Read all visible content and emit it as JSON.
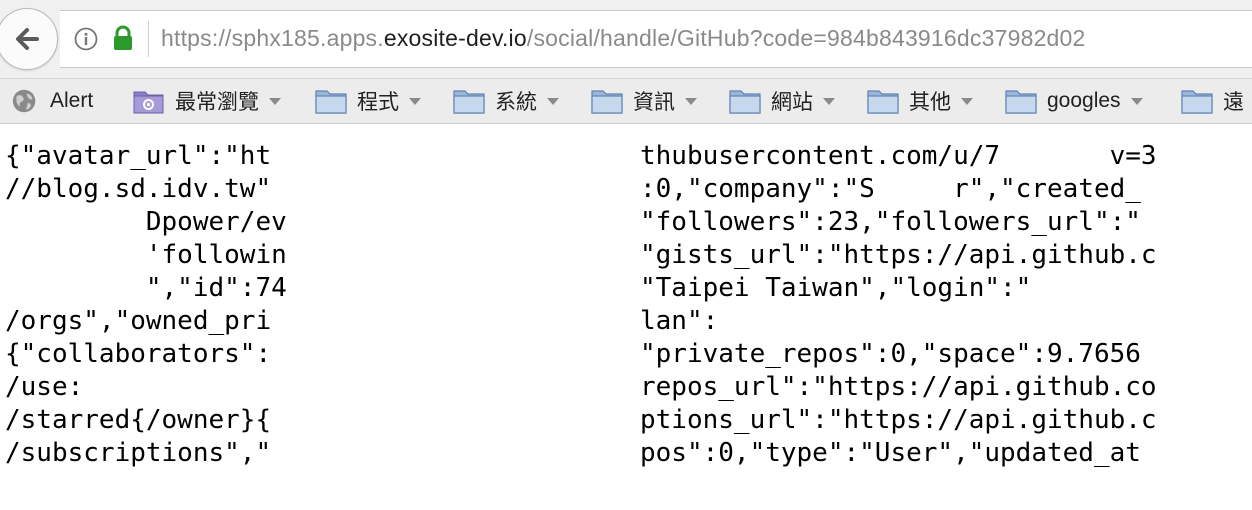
{
  "browser": {
    "url": {
      "prefix": "https://sphx185.apps.",
      "host": "exosite-dev.io",
      "path": "/social/handle/GitHub?code=984b843916dc37982d02"
    },
    "icons": {
      "back": "back-arrow-icon",
      "info": "info-icon",
      "lock": "lock-icon"
    },
    "colors": {
      "lock": "#2b9a2b",
      "url_dim": "#8a8a8a",
      "url_host": "#1f1f1f"
    }
  },
  "bookmarks": [
    {
      "label": "Alert",
      "icon": "globe-icon",
      "dropdown": false
    },
    {
      "label": "最常瀏覽",
      "icon": "smart-folder-icon",
      "dropdown": true
    },
    {
      "label": "程式",
      "icon": "folder-icon",
      "dropdown": true
    },
    {
      "label": "系統",
      "icon": "folder-icon",
      "dropdown": true
    },
    {
      "label": "資訊",
      "icon": "folder-icon",
      "dropdown": true
    },
    {
      "label": "網站",
      "icon": "folder-icon",
      "dropdown": true
    },
    {
      "label": "其他",
      "icon": "folder-icon",
      "dropdown": true
    },
    {
      "label": "googles",
      "icon": "folder-icon",
      "dropdown": true
    },
    {
      "label": "遠",
      "icon": "folder-icon",
      "dropdown": false
    }
  ],
  "json_left": [
    "{\"avatar_url\":\"ht",
    "//blog.sd.idv.tw\"",
    "         Dpower/ev",
    "         'followin",
    "         \",\"id\":74",
    "/orgs\",\"owned_pri",
    "{\"collaborators\":",
    "/use:",
    "/starred{/owner}{",
    "/subscriptions\",\""
  ],
  "json_right": [
    "thubusercontent.com/u/7       v=3",
    ":0,\"company\":\"S     r\",\"created_",
    "\"followers\":23,\"followers_url\":\"",
    "\"gists_url\":\"https://api.github.c",
    "\"Taipei Taiwan\",\"login\":\"",
    "lan\":",
    "\"private_repos\":0,\"space\":9.7656",
    "repos_url\":\"https://api.github.co",
    "ptions_url\":\"https://api.github.c",
    "pos\":0,\"type\":\"User\",\"updated_at"
  ]
}
